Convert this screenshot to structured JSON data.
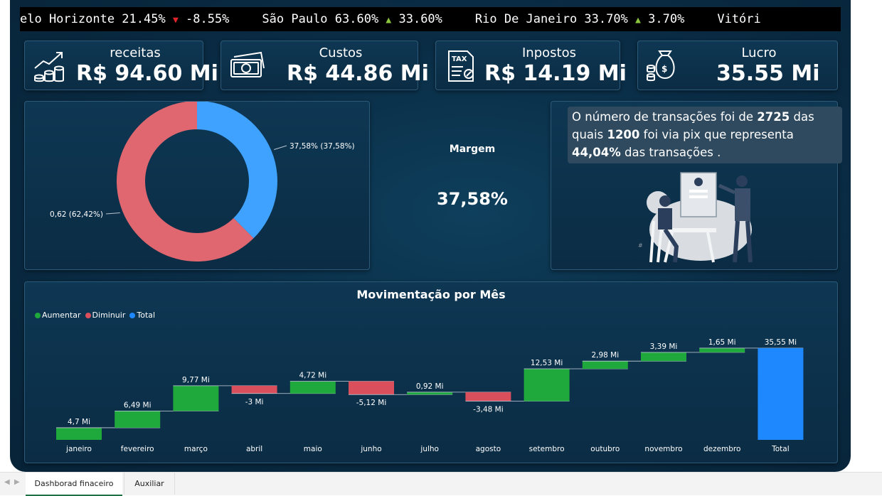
{
  "ticker": [
    {
      "city": "elo Horizonte",
      "pct": "21.45%",
      "dir": "down",
      "change": "-8.55%"
    },
    {
      "city": "São Paulo",
      "pct": "63.60%",
      "dir": "up",
      "change": "33.60%"
    },
    {
      "city": "Rio De Janeiro",
      "pct": "33.70%",
      "dir": "up",
      "change": "3.70%"
    },
    {
      "city": "Vitóri",
      "pct": "",
      "dir": "",
      "change": ""
    }
  ],
  "kpis": [
    {
      "label": "receitas",
      "value": "R$ 94.60 Mi",
      "icon": "coins-growth-icon"
    },
    {
      "label": "Custos",
      "value": "R$ 44.86 Mi",
      "icon": "cash-icon"
    },
    {
      "label": "Inpostos",
      "value": "R$ 14.19 Mi",
      "icon": "tax-document-icon"
    },
    {
      "label": "Lucro",
      "value": "35.55 Mi",
      "icon": "money-bag-icon"
    }
  ],
  "margin": {
    "label": "Margem",
    "value": "37,58%"
  },
  "info": {
    "part1": "O número de transações foi de ",
    "transactions": "2725",
    "part2": " das quais ",
    "pix": "1200",
    "part3": " foi via pix que representa ",
    "pct": "44,04%",
    "part4": " das transações ."
  },
  "colors": {
    "increase": "#1fa83c",
    "decrease": "#d9505c",
    "total": "#1e88ff",
    "donut_blue": "#3fa2ff",
    "donut_red": "#e0666f",
    "up_arrow": "#8cc63e",
    "down_arrow": "#e0252b"
  },
  "chart_data": [
    {
      "type": "pie",
      "subtype": "donut",
      "slices": [
        {
          "value": 37.58,
          "label": "37,58% (37,58%)",
          "color": "#3fa2ff"
        },
        {
          "value": 62.42,
          "label": "0,62 (62,42%)",
          "color": "#e0666f"
        }
      ]
    },
    {
      "type": "bar",
      "subtype": "waterfall",
      "title": "Movimentação por Mês",
      "legend": {
        "placement": "top-left",
        "entries": [
          "Aumentar",
          "Diminuir",
          "Total"
        ]
      },
      "categories": [
        "janeiro",
        "fevereiro",
        "março",
        "abril",
        "maio",
        "junho",
        "julho",
        "agosto",
        "setembro",
        "outubro",
        "novembro",
        "dezembro",
        "Total"
      ],
      "values": [
        4.7,
        6.49,
        9.77,
        -3,
        4.72,
        -5.12,
        0.92,
        -3.48,
        12.53,
        2.98,
        3.39,
        1.65,
        35.55
      ],
      "labels": [
        "4,7 Mi",
        "6,49 Mi",
        "9,77 Mi",
        "-3 Mi",
        "4,72 Mi",
        "-5,12 Mi",
        "0,92 Mi",
        "-3,48 Mi",
        "12,53 Mi",
        "2,98 Mi",
        "3,39 Mi",
        "1,65 Mi",
        "35,55 Mi"
      ],
      "ylim": [
        0,
        38
      ]
    }
  ],
  "tabs": [
    "Dashborad finaceiro",
    "Auxiliar"
  ]
}
